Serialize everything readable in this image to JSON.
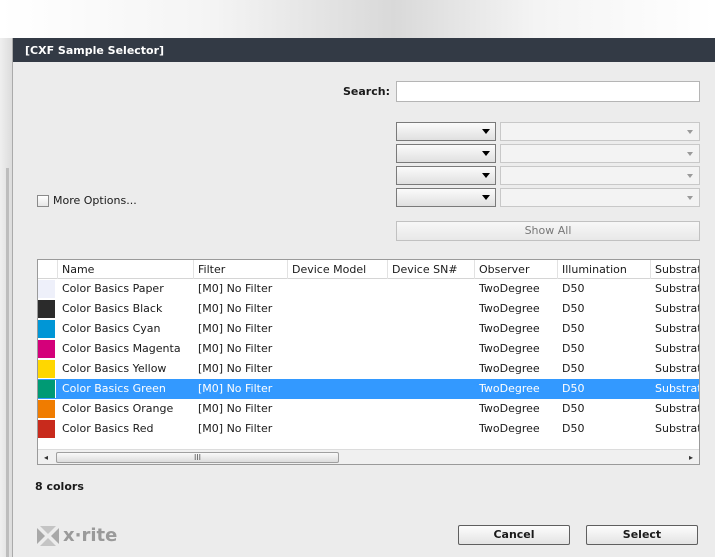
{
  "dialog": {
    "title": "[CXF Sample Selector]"
  },
  "search": {
    "label": "Search:",
    "value": ""
  },
  "filters": [
    {
      "field": "",
      "value": ""
    },
    {
      "field": "",
      "value": ""
    },
    {
      "field": "",
      "value": ""
    },
    {
      "field": "",
      "value": ""
    }
  ],
  "more_options": {
    "label": "More Options...",
    "checked": false
  },
  "show_all": {
    "label": "Show All"
  },
  "table": {
    "columns": [
      "Name",
      "Filter",
      "Device Model",
      "Device SN#",
      "Observer",
      "Illumination",
      "Substrat"
    ],
    "rows": [
      {
        "color": "#eef0fa",
        "name": "Color Basics Paper",
        "filter": "[M0] No Filter",
        "model": "",
        "sn": "",
        "observer": "TwoDegree",
        "illumination": "D50",
        "substrate": "Substrat"
      },
      {
        "color": "#2b2b2b",
        "name": "Color Basics Black",
        "filter": "[M0] No Filter",
        "model": "",
        "sn": "",
        "observer": "TwoDegree",
        "illumination": "D50",
        "substrate": "Substrat"
      },
      {
        "color": "#0096d6",
        "name": "Color Basics Cyan",
        "filter": "[M0] No Filter",
        "model": "",
        "sn": "",
        "observer": "TwoDegree",
        "illumination": "D50",
        "substrate": "Substrat"
      },
      {
        "color": "#d4007a",
        "name": "Color Basics Magenta",
        "filter": "[M0] No Filter",
        "model": "",
        "sn": "",
        "observer": "TwoDegree",
        "illumination": "D50",
        "substrate": "Substrat"
      },
      {
        "color": "#ffd700",
        "name": "Color Basics Yellow",
        "filter": "[M0] No Filter",
        "model": "",
        "sn": "",
        "observer": "TwoDegree",
        "illumination": "D50",
        "substrate": "Substrat"
      },
      {
        "color": "#009a74",
        "name": "Color Basics Green",
        "filter": "[M0] No Filter",
        "model": "",
        "sn": "",
        "observer": "TwoDegree",
        "illumination": "D50",
        "substrate": "Substrat"
      },
      {
        "color": "#f07c00",
        "name": "Color Basics Orange",
        "filter": "[M0] No Filter",
        "model": "",
        "sn": "",
        "observer": "TwoDegree",
        "illumination": "D50",
        "substrate": "Substrat"
      },
      {
        "color": "#c82a1c",
        "name": "Color Basics Red",
        "filter": "[M0] No Filter",
        "model": "",
        "sn": "",
        "observer": "TwoDegree",
        "illumination": "D50",
        "substrate": "Substrat"
      }
    ],
    "selected_row": 5,
    "selection_color": "#3399ff"
  },
  "scrollbar": {
    "left_arrow": "◂",
    "right_arrow": "▸",
    "grip": "III"
  },
  "status": {
    "count": "8 colors"
  },
  "brand": {
    "name": "x·rite"
  },
  "buttons": {
    "cancel": "Cancel",
    "select": "Select"
  }
}
